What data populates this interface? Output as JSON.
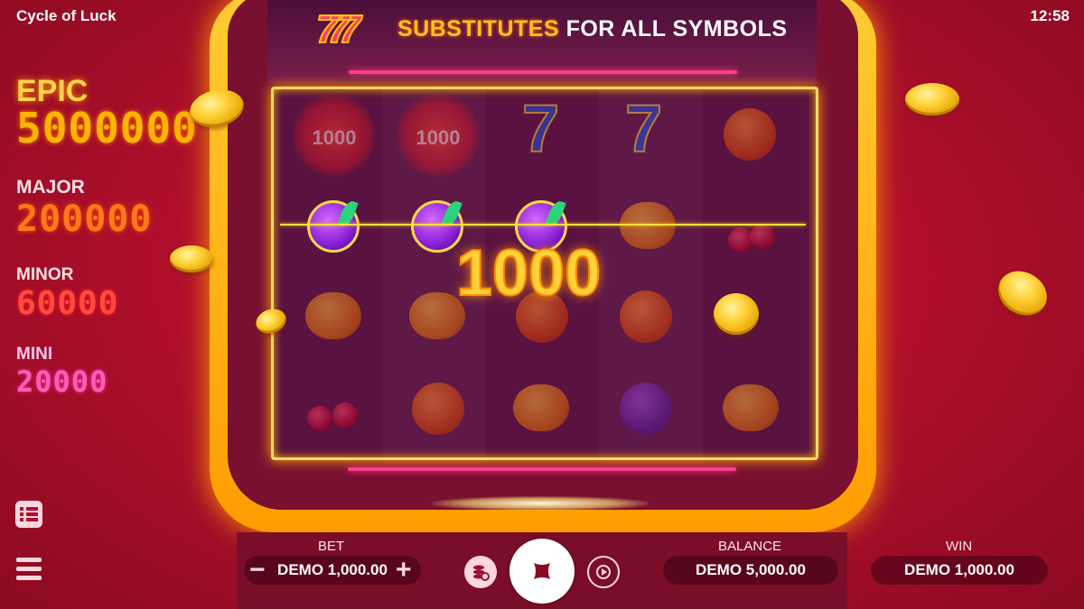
{
  "app": {
    "title": "Cycle of Luck",
    "clock": "12:58"
  },
  "jackpots": [
    {
      "label": "EPIC",
      "value": "5000000"
    },
    {
      "label": "MAJOR",
      "value": "200000"
    },
    {
      "label": "MINOR",
      "value": "60000"
    },
    {
      "label": "MINI",
      "value": "20000"
    }
  ],
  "banner": {
    "highlight": "SUBSTITUTES",
    "text": "FOR ALL SYMBOLS",
    "symbol_icon": "triple-seven-icon"
  },
  "reels": {
    "bonus_value": "1000",
    "win_amount": "1000",
    "grid": [
      [
        "bonus-1000",
        "plum",
        "lemon",
        "cherry"
      ],
      [
        "bonus-1000",
        "plum",
        "lemon",
        "orange"
      ],
      [
        "seven",
        "plum",
        "orange",
        "lemon"
      ],
      [
        "seven",
        "lemon",
        "orange",
        "plum"
      ],
      [
        "orange",
        "cherry",
        "cherry",
        "lemon"
      ]
    ],
    "payline_row": 2
  },
  "controls": {
    "bet_label": "BET",
    "bet_value": "DEMO 1,000.00",
    "balance_label": "BALANCE",
    "balance_value": "DEMO 5,000.00",
    "win_label": "WIN",
    "win_value": "DEMO 1,000.00",
    "left_icons": [
      "paytable-icon",
      "menu-icon"
    ],
    "round_buttons": [
      "bet-settings-icon",
      "stop-icon",
      "autoplay-icon"
    ]
  },
  "colors": {
    "background": "#b20f2c",
    "frame": "#ffb400",
    "neon": "#ff3d8a",
    "payline": "#ffe23a"
  }
}
